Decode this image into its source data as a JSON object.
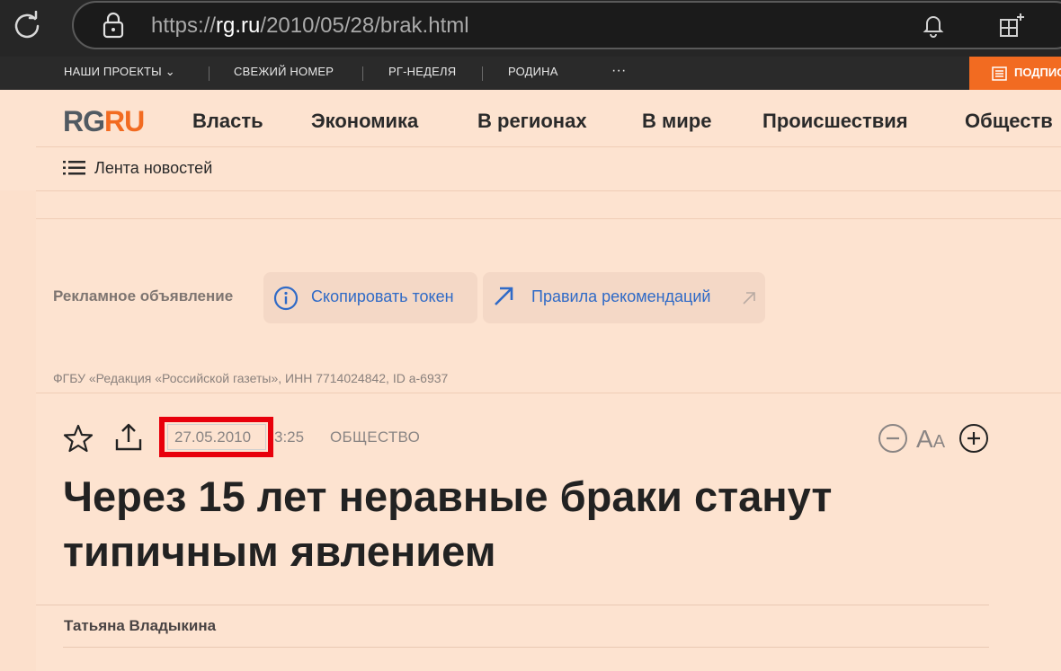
{
  "browser": {
    "url_prefix": "https://",
    "url_host": "rg.ru",
    "url_path": "/2010/05/28/brak.html"
  },
  "topstrip": {
    "items": [
      "НАШИ ПРОЕКТЫ",
      "СВЕЖИЙ НОМЕР",
      "РГ-НЕДЕЛЯ",
      "РОДИНА",
      "···"
    ],
    "subscribe": "ПОДПИС"
  },
  "header": {
    "logo_rg": "RG",
    "logo_ru": "RU",
    "nav": [
      "Власть",
      "Экономика",
      "В регионах",
      "В мире",
      "Происшествия",
      "Обществ"
    ],
    "feed": "Лента новостей"
  },
  "ad": {
    "label": "Рекламное объявление",
    "copy_token": "Скопировать токен",
    "rules": "Правила рекомендаций",
    "owner": "ФГБУ «Редакция «Российской газеты», ИНН 7714024842, ID a-6937"
  },
  "article": {
    "date": "27.05.2010",
    "time": "3:25",
    "rubric": "ОБЩЕСТВО",
    "font_label_big": "A",
    "font_label_small": "A",
    "headline": "Через 15 лет неравные браки станут типичным явлением",
    "author": "Татьяна Владыкина"
  },
  "colors": {
    "page_bg": "#fde3d0",
    "accent": "#f26b21",
    "highlight": "#e8000b",
    "link": "#2f6ac7"
  }
}
